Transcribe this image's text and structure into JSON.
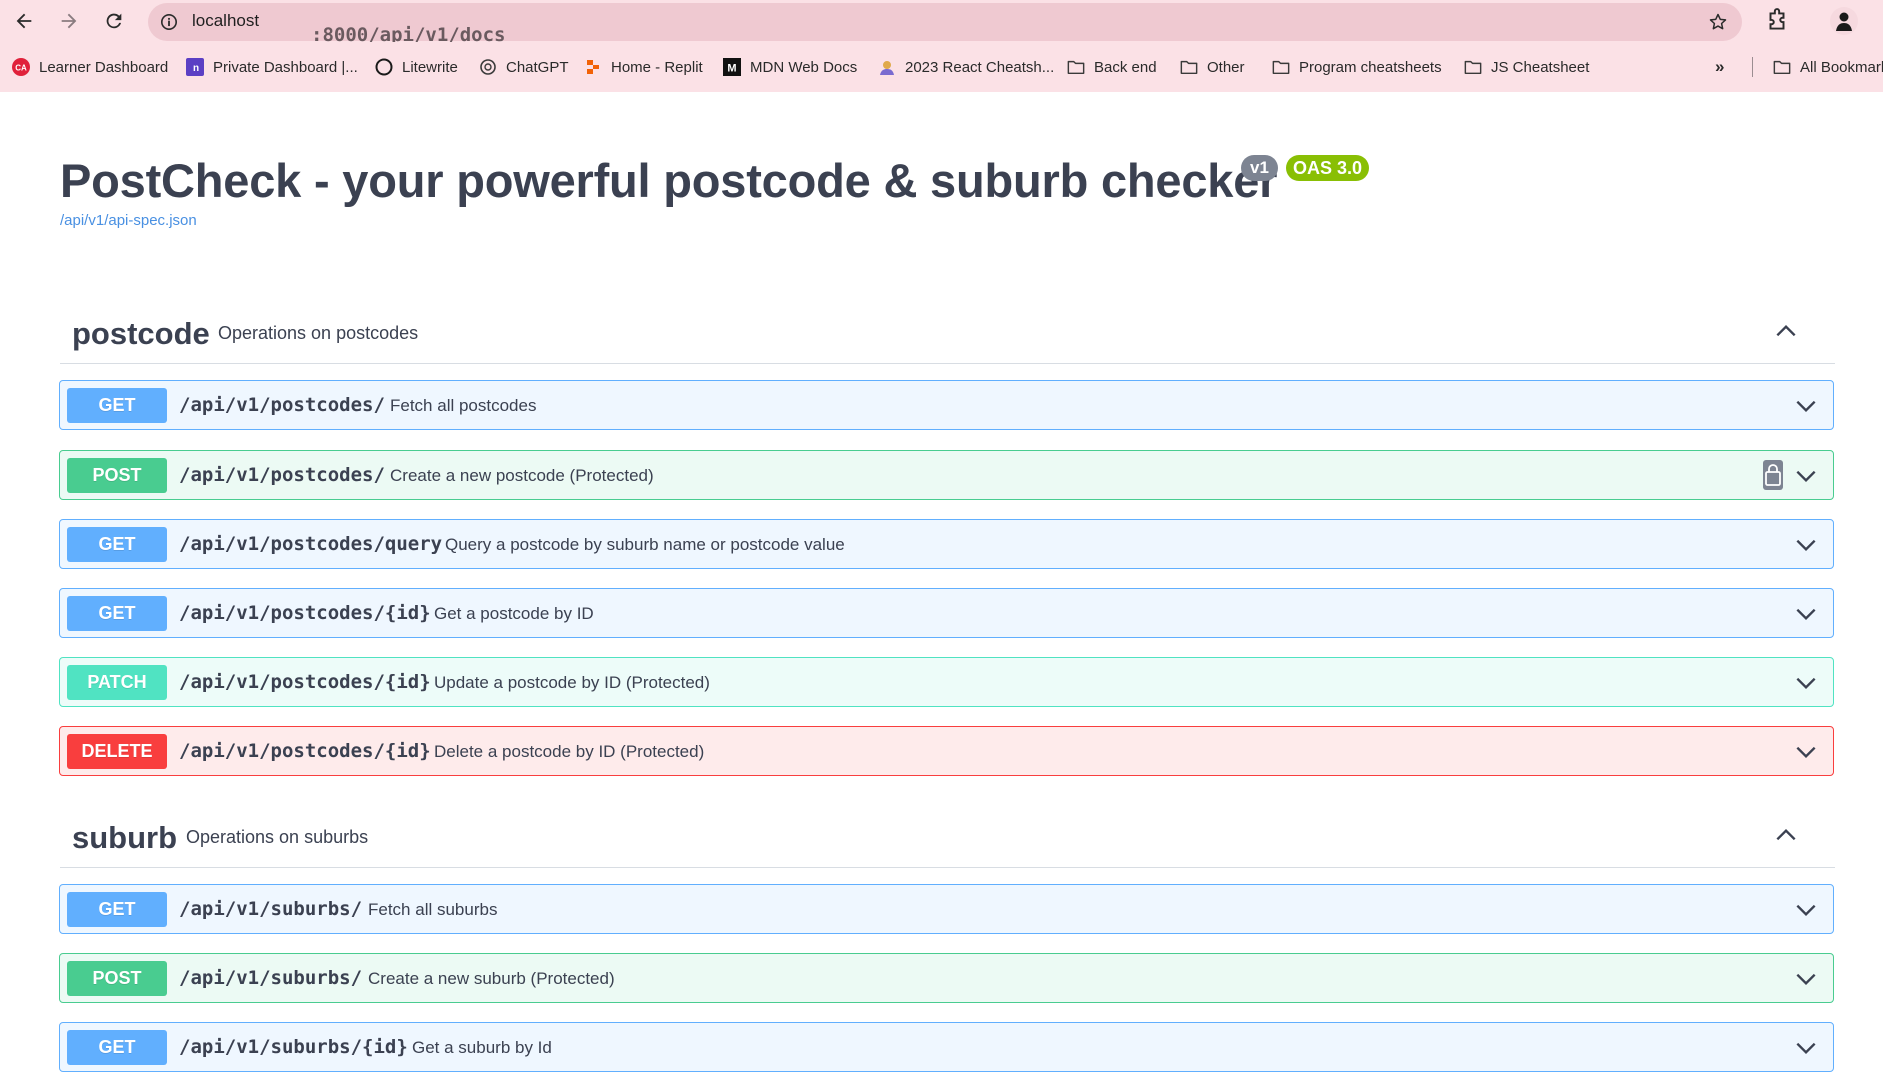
{
  "browser": {
    "url_host": "localhost",
    "url_path": ":8000/api/v1/docs",
    "bookmarks": [
      {
        "label": "Learner Dashboard",
        "icon": "ca-logo-icon"
      },
      {
        "label": "Private Dashboard |...",
        "icon": "private-dashboard-icon"
      },
      {
        "label": "Litewrite",
        "icon": "litewrite-circle-icon"
      },
      {
        "label": "ChatGPT",
        "icon": "chatgpt-icon"
      },
      {
        "label": "Home - Replit",
        "icon": "replit-icon"
      },
      {
        "label": "MDN Web Docs",
        "icon": "mdn-icon"
      },
      {
        "label": "2023 React Cheatsh...",
        "icon": "react-cheatsheet-icon"
      },
      {
        "label": "Back end",
        "icon": "folder-icon"
      },
      {
        "label": "Other",
        "icon": "folder-icon"
      },
      {
        "label": "Program cheatsheets",
        "icon": "folder-icon"
      },
      {
        "label": "JS Cheatsheet",
        "icon": "folder-icon"
      },
      {
        "label": "All Bookmarks",
        "icon": "folder-icon"
      }
    ],
    "overflow_label": "»"
  },
  "header": {
    "title": "PostCheck - your powerful postcode & suburb checker",
    "version_badge": "v1",
    "oas_badge": "OAS 3.0",
    "spec_link": "/api/v1/api-spec.json"
  },
  "tags": [
    {
      "name": "postcode",
      "description": "Operations on postcodes",
      "operations": [
        {
          "method": "GET",
          "path": "/api/v1/postcodes/",
          "summary": "Fetch all postcodes"
        },
        {
          "method": "POST",
          "path": "/api/v1/postcodes/",
          "summary": "Create a new postcode (Protected)"
        },
        {
          "method": "GET",
          "path": "/api/v1/postcodes/query",
          "summary": "Query a postcode by suburb name or postcode value"
        },
        {
          "method": "GET",
          "path": "/api/v1/postcodes/{id}",
          "summary": "Get a postcode by ID"
        },
        {
          "method": "PATCH",
          "path": "/api/v1/postcodes/{id}",
          "summary": "Update a postcode by ID (Protected)"
        },
        {
          "method": "DELETE",
          "path": "/api/v1/postcodes/{id}",
          "summary": "Delete a postcode by ID (Protected)"
        }
      ]
    },
    {
      "name": "suburb",
      "description": "Operations on suburbs",
      "operations": [
        {
          "method": "GET",
          "path": "/api/v1/suburbs/",
          "summary": "Fetch all suburbs"
        },
        {
          "method": "POST",
          "path": "/api/v1/suburbs/",
          "summary": "Create a new suburb (Protected)"
        },
        {
          "method": "GET",
          "path": "/api/v1/suburbs/{id}",
          "summary": "Get a suburb by Id"
        }
      ]
    }
  ],
  "colors": {
    "get": "#61affe",
    "post": "#49cc90",
    "patch": "#50e3c2",
    "delete": "#f93e3e",
    "chrome_bg": "#fbe1e6",
    "omnibox_bg": "#efc9d1"
  }
}
